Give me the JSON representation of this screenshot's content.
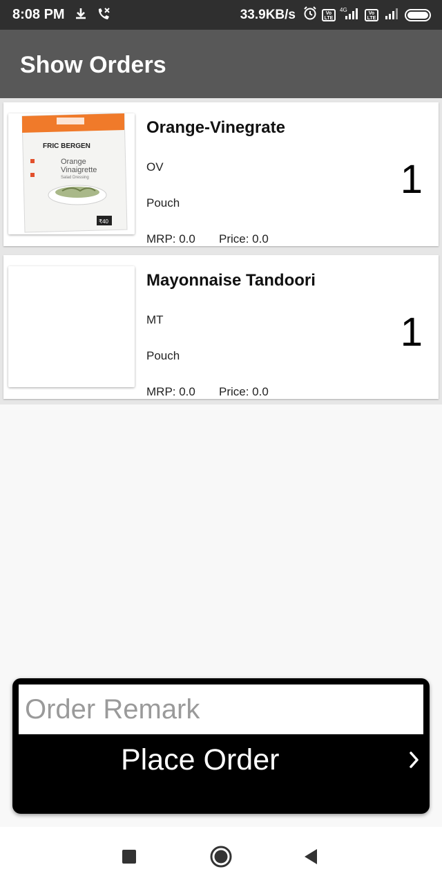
{
  "status_bar": {
    "time": "8:08 PM",
    "speed": "33.9KB/s",
    "network_4g": "4G",
    "volte_label": "Vo LTE"
  },
  "app_bar": {
    "title": "Show Orders"
  },
  "orders": [
    {
      "name": "Orange-Vinegrate",
      "code": "OV",
      "pack": "Pouch",
      "mrp": "MRP: 0.0",
      "price": "Price: 0.0",
      "qty": "1",
      "has_image": true
    },
    {
      "name": "Mayonnaise Tandoori",
      "code": "MT",
      "pack": "Pouch",
      "mrp": "MRP: 0.0",
      "price": "Price: 0.0",
      "qty": "1",
      "has_image": false
    }
  ],
  "product_image": {
    "brand": "FRIC BERGEN",
    "line1": "Orange",
    "line2": "Vinaigrette",
    "line3": "Salad Dressing",
    "price_tag": "₹40"
  },
  "order_panel": {
    "remark_placeholder": "Order Remark",
    "place_order_label": "Place Order"
  },
  "colors": {
    "status_bar": "#2f2f2f",
    "app_bar": "#585858",
    "panel": "#000000",
    "accent_orange": "#f07a2a"
  },
  "icons": [
    "download-icon",
    "call-forward-icon",
    "alarm-icon",
    "signal-icon",
    "battery-icon",
    "chevron-right-icon",
    "recents-icon",
    "home-icon",
    "back-icon"
  ]
}
